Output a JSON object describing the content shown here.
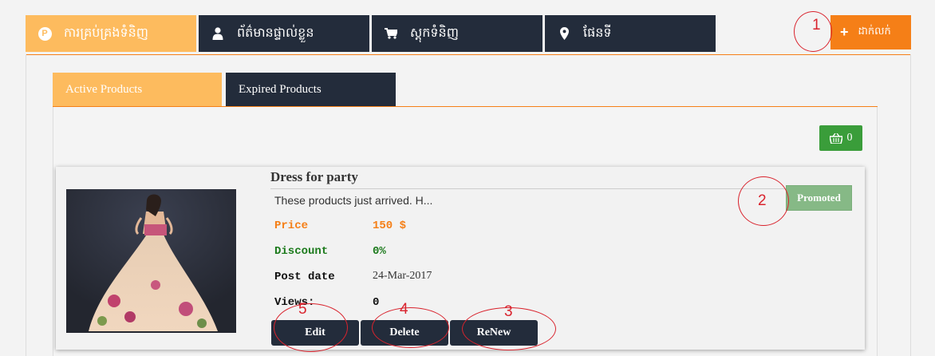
{
  "topnav": {
    "tabs": [
      {
        "label": "ការគ្រប់គ្រងទំនិញ",
        "icon": "coin-icon",
        "icon_glyph": "P"
      },
      {
        "label": "ព័ត៌មានផ្ទាល់ខ្លួន",
        "icon": "user-icon"
      },
      {
        "label": "ស្តុកទំនិញ",
        "icon": "cart-icon"
      },
      {
        "label": "ផែនទី",
        "icon": "map-marker-icon"
      }
    ],
    "add_label": "ដាក់លក់",
    "add_icon": "plus-icon"
  },
  "subtabs": {
    "active": "Active Products",
    "expired": "Expired Products"
  },
  "cart": {
    "count": "0",
    "icon": "basket-icon"
  },
  "product": {
    "title": "Dress for party",
    "description": "These products just arrived. H...",
    "price_label": "Price",
    "price_value": "150 $",
    "discount_label": "Discount",
    "discount_value": "0%",
    "post_date_label": "Post date",
    "post_date_value": "24-Mar-2017",
    "views_label": "Views:",
    "views_value": "0",
    "badge": "Promoted"
  },
  "actions": {
    "edit": "Edit",
    "delete": "Delete",
    "renew": "ReNew"
  },
  "annotations": [
    "1",
    "2",
    "3",
    "4",
    "5"
  ],
  "colors": {
    "accent_orange": "#f57f17",
    "tab_active": "#fdbb5e",
    "tab_dark": "#232c3b",
    "promoted_green": "#86b986",
    "cart_green": "#3a9d3a",
    "annotation_red": "#d9232d"
  }
}
